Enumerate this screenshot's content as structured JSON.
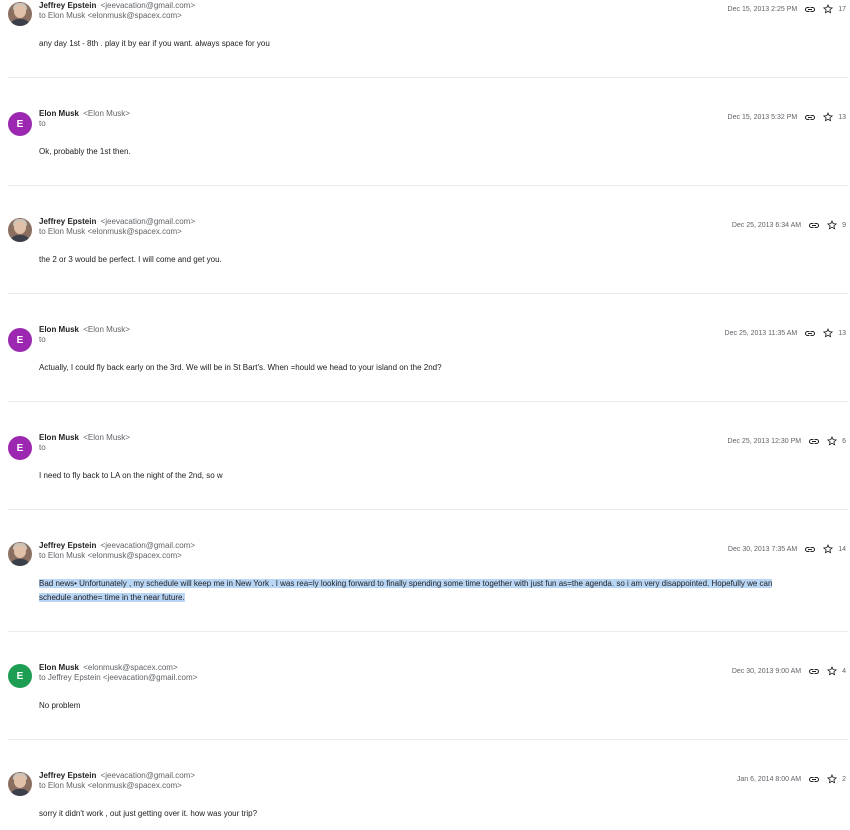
{
  "messages": [
    {
      "sender_name": "Jeffrey Epstein",
      "sender_addr": "<jeevacation@gmail.com>",
      "recipient": "to Elon Musk <elonmusk@spacex.com>",
      "date": "Dec 15, 2013 2:25 PM",
      "count": "17",
      "body": "any day 1st - 8th . play it by ear if you want. always space for you",
      "avatar": "photo",
      "avatar_letter": "",
      "avatar_color": ""
    },
    {
      "sender_name": "Elon Musk",
      "sender_addr": "<Elon Musk>",
      "recipient": "to",
      "date": "Dec 15, 2013 5:32 PM",
      "count": "13",
      "body": "Ok, probably the 1st then.",
      "avatar": "letter",
      "avatar_letter": "E",
      "avatar_color": "#9c27b0"
    },
    {
      "sender_name": "Jeffrey Epstein",
      "sender_addr": "<jeevacation@gmail.com>",
      "recipient": "to Elon Musk <elonmusk@spacex.com>",
      "date": "Dec 25, 2013 6:34 AM",
      "count": "9",
      "body": "the 2 or 3 would be perfect. I will come and get you.",
      "avatar": "photo",
      "avatar_letter": "",
      "avatar_color": ""
    },
    {
      "sender_name": "Elon Musk",
      "sender_addr": "<Elon Musk>",
      "recipient": "to",
      "date": "Dec 25, 2013 11:35 AM",
      "count": "13",
      "body": "Actually, I could fly back early on the 3rd. We will be in St Bart's. When =hould we head to your island on the 2nd?",
      "avatar": "letter",
      "avatar_letter": "E",
      "avatar_color": "#9c27b0"
    },
    {
      "sender_name": "Elon Musk",
      "sender_addr": "<Elon Musk>",
      "recipient": "to",
      "date": "Dec 25, 2013 12:30 PM",
      "count": "6",
      "body": "I need to fly back to LA on the night of the 2nd, so w",
      "avatar": "letter",
      "avatar_letter": "E",
      "avatar_color": "#9c27b0"
    },
    {
      "sender_name": "Jeffrey Epstein",
      "sender_addr": "<jeevacation@gmail.com>",
      "recipient": "to Elon Musk <elonmusk@spacex.com>",
      "date": "Dec 30, 2013 7:35 AM",
      "count": "14",
      "body": "",
      "body_line1": "Bad news• Unfortunately , my schedule will keep me in New York . I was rea=ly looking forward to finally spending some time together with just fun as=the agenda. so i am very disappointed. Hopefully we can",
      "body_line2": "schedule anothe= time in the near future.",
      "avatar": "photo",
      "avatar_letter": "",
      "avatar_color": ""
    },
    {
      "sender_name": "Elon Musk",
      "sender_addr": "<elonmusk@spacex.com>",
      "recipient": "to Jeffrey Epstein <jeevacation@gmail.com>",
      "date": "Dec 30, 2013 9:00 AM",
      "count": "4",
      "body": "No problem",
      "avatar": "letter",
      "avatar_letter": "E",
      "avatar_color": "#1e9e53"
    },
    {
      "sender_name": "Jeffrey Epstein",
      "sender_addr": "<jeevacation@gmail.com>",
      "recipient": "to Elon Musk <elonmusk@spacex.com>",
      "date": "Jan 6, 2014 8:00 AM",
      "count": "2",
      "body": "sorry it didn't work , out just getting over it. how was your trip?",
      "avatar": "photo",
      "avatar_letter": "",
      "avatar_color": ""
    }
  ],
  "icons": {
    "link": "link-icon",
    "star": "star-outline-icon"
  }
}
